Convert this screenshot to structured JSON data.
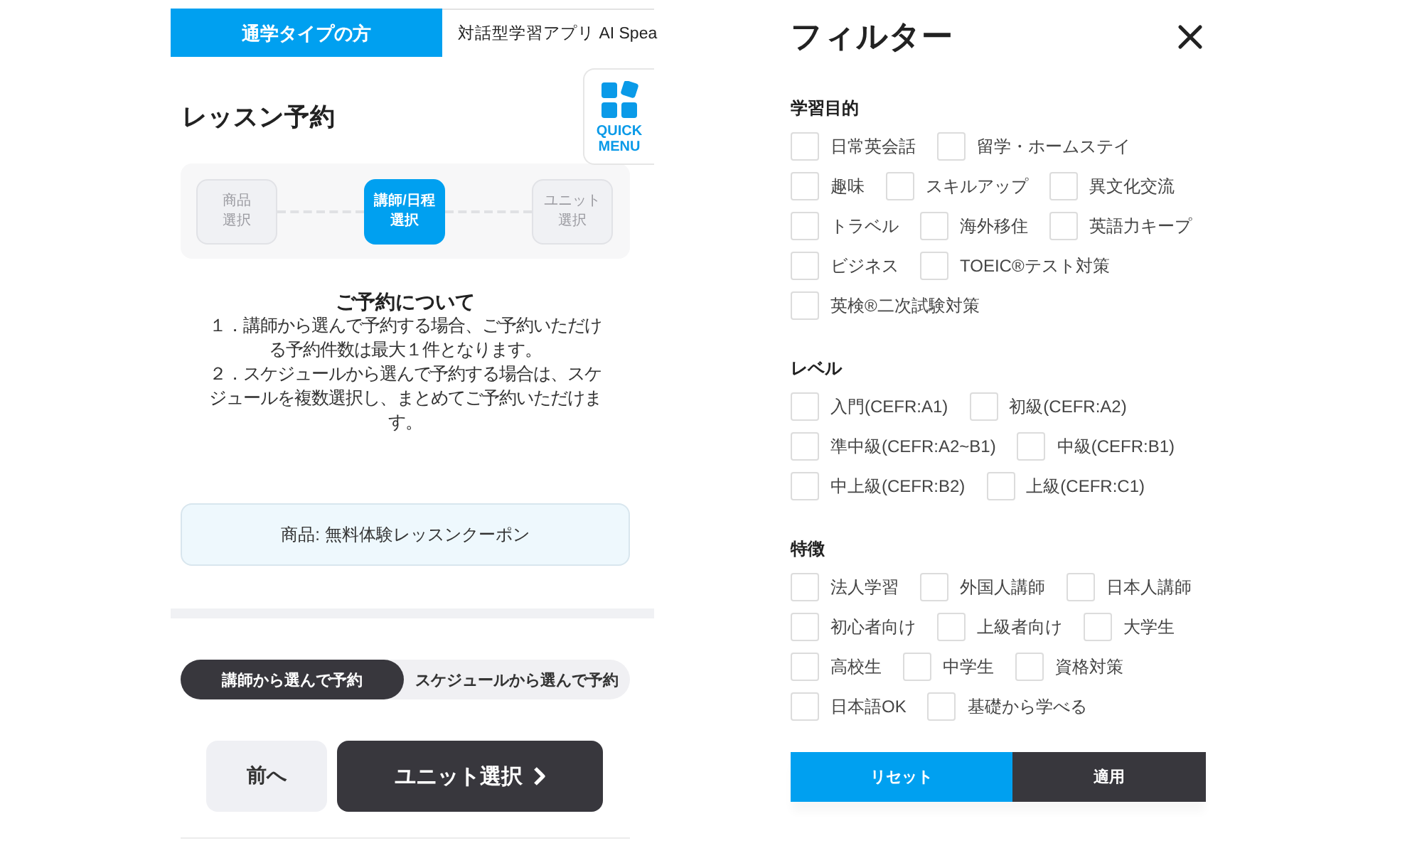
{
  "left_screen": {
    "tabs": [
      {
        "label": "通学タイプの方",
        "selected": true
      },
      {
        "label": "対話型学習アプリ AI Spea",
        "selected": false
      }
    ],
    "title": "レッスン予約",
    "quick_menu": {
      "label": "QUICK\nMENU"
    },
    "steps": [
      {
        "lines": [
          "商品",
          "選択"
        ],
        "active": false
      },
      {
        "lines": [
          "講師/日程",
          "選択"
        ],
        "active": true
      },
      {
        "lines": [
          "ユニット",
          "選択"
        ],
        "active": false
      }
    ],
    "notice": {
      "heading": "ご予約について",
      "items": [
        "１．講師から選んで予約する場合、ご予約いただける予約件数は最大１件となります。",
        "２．スケジュールから選んで予約する場合は、スケジュールを複数選択し、まとめてご予約いただけます。"
      ]
    },
    "product": "商品: 無料体験レッスンクーポン",
    "booking_mode": [
      {
        "label": "講師から選んで予約",
        "selected": true
      },
      {
        "label": "スケジュールから選んで予約",
        "selected": false
      }
    ],
    "buttons": [
      {
        "label": "前へ",
        "kind": "back"
      },
      {
        "label": "ユニット選択",
        "kind": "next"
      }
    ]
  },
  "filter": {
    "title": "フィルター",
    "sections": [
      {
        "heading": "学習目的",
        "options": [
          {
            "label": "日常英会話",
            "checked": false
          },
          {
            "label": "留学・ホームステイ",
            "checked": false
          },
          {
            "label": "趣味",
            "checked": false
          },
          {
            "label": "スキルアップ",
            "checked": false
          },
          {
            "label": "異文化交流",
            "checked": false
          },
          {
            "label": "トラベル",
            "checked": false
          },
          {
            "label": "海外移住",
            "checked": false
          },
          {
            "label": "英語力キープ",
            "checked": false
          },
          {
            "label": "ビジネス",
            "checked": false
          },
          {
            "label": "TOEIC®テスト対策",
            "checked": false
          },
          {
            "label": "英検®二次試験対策",
            "checked": false
          }
        ]
      },
      {
        "heading": "レベル",
        "options": [
          {
            "label": "入門(CEFR:A1)",
            "checked": false
          },
          {
            "label": "初級(CEFR:A2)",
            "checked": false
          },
          {
            "label": "準中級(CEFR:A2~B1)",
            "checked": false
          },
          {
            "label": "中級(CEFR:B1)",
            "checked": false
          },
          {
            "label": "中上級(CEFR:B2)",
            "checked": false
          },
          {
            "label": "上級(CEFR:C1)",
            "checked": false
          }
        ]
      },
      {
        "heading": "特徴",
        "options": [
          {
            "label": "法人学習",
            "checked": false
          },
          {
            "label": "外国人講師",
            "checked": false
          },
          {
            "label": "日本人講師",
            "checked": false
          },
          {
            "label": "初心者向け",
            "checked": false
          },
          {
            "label": "上級者向け",
            "checked": false
          },
          {
            "label": "大学生",
            "checked": false
          },
          {
            "label": "高校生",
            "checked": false
          },
          {
            "label": "中学生",
            "checked": false
          },
          {
            "label": "資格対策",
            "checked": false
          },
          {
            "label": "日本語OK",
            "checked": false
          },
          {
            "label": "基礎から学べる",
            "checked": false
          }
        ]
      }
    ],
    "buttons": [
      {
        "label": "リセット",
        "kind": "reset"
      },
      {
        "label": "適用",
        "kind": "apply"
      }
    ]
  }
}
